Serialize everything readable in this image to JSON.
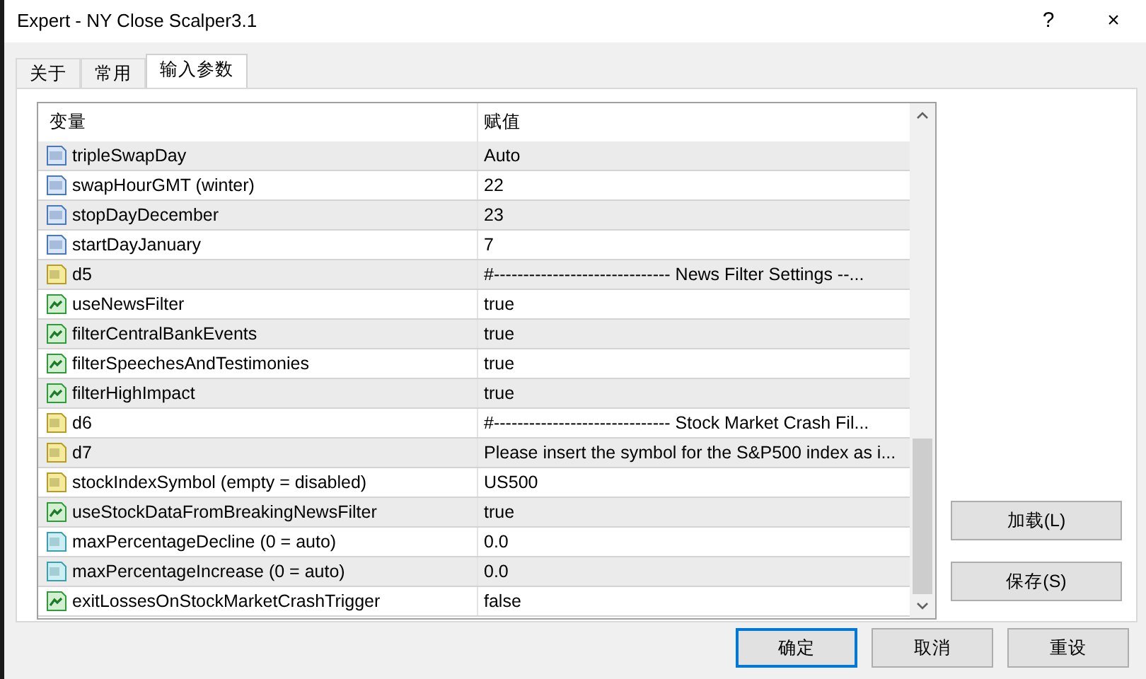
{
  "window": {
    "title": "Expert - NY Close Scalper3.1",
    "controls": [
      "?",
      "×"
    ]
  },
  "tabs": [
    {
      "label": "关于",
      "selected": false
    },
    {
      "label": "常用",
      "selected": false
    },
    {
      "label": "输入参数",
      "selected": true
    }
  ],
  "table": {
    "columns": [
      "变量",
      "赋值"
    ],
    "rows": [
      {
        "kind": "int",
        "name": "tripleSwapDay",
        "value": "Auto"
      },
      {
        "kind": "int",
        "name": "swapHourGMT (winter)",
        "value": "22"
      },
      {
        "kind": "int",
        "name": "stopDayDecember",
        "value": "23"
      },
      {
        "kind": "int",
        "name": "startDayJanuary",
        "value": "7"
      },
      {
        "kind": "string",
        "name": "d5",
        "value": "#------------------------------ News Filter Settings --..."
      },
      {
        "kind": "bool",
        "name": "useNewsFilter",
        "value": "true"
      },
      {
        "kind": "bool",
        "name": "filterCentralBankEvents",
        "value": "true"
      },
      {
        "kind": "bool",
        "name": "filterSpeechesAndTestimonies",
        "value": "true"
      },
      {
        "kind": "bool",
        "name": "filterHighImpact",
        "value": "true"
      },
      {
        "kind": "string",
        "name": "d6",
        "value": "#------------------------------ Stock Market Crash Fil..."
      },
      {
        "kind": "string",
        "name": "d7",
        "value": "Please insert the symbol for the S&P500 index as i..."
      },
      {
        "kind": "string",
        "name": "stockIndexSymbol (empty = disabled)",
        "value": "US500"
      },
      {
        "kind": "bool",
        "name": "useStockDataFromBreakingNewsFilter",
        "value": "true"
      },
      {
        "kind": "double",
        "name": "maxPercentageDecline (0 = auto)",
        "value": "0.0"
      },
      {
        "kind": "double",
        "name": "maxPercentageIncrease (0 = auto)",
        "value": "0.0"
      },
      {
        "kind": "bool",
        "name": "exitLossesOnStockMarketCrashTrigger",
        "value": "false"
      }
    ]
  },
  "side_buttons": [
    "加载(L)",
    "保存(S)"
  ],
  "dialog_buttons": [
    {
      "label": "确定",
      "focused": true
    },
    {
      "label": "取消",
      "focused": false
    },
    {
      "label": "重设",
      "focused": false
    }
  ]
}
